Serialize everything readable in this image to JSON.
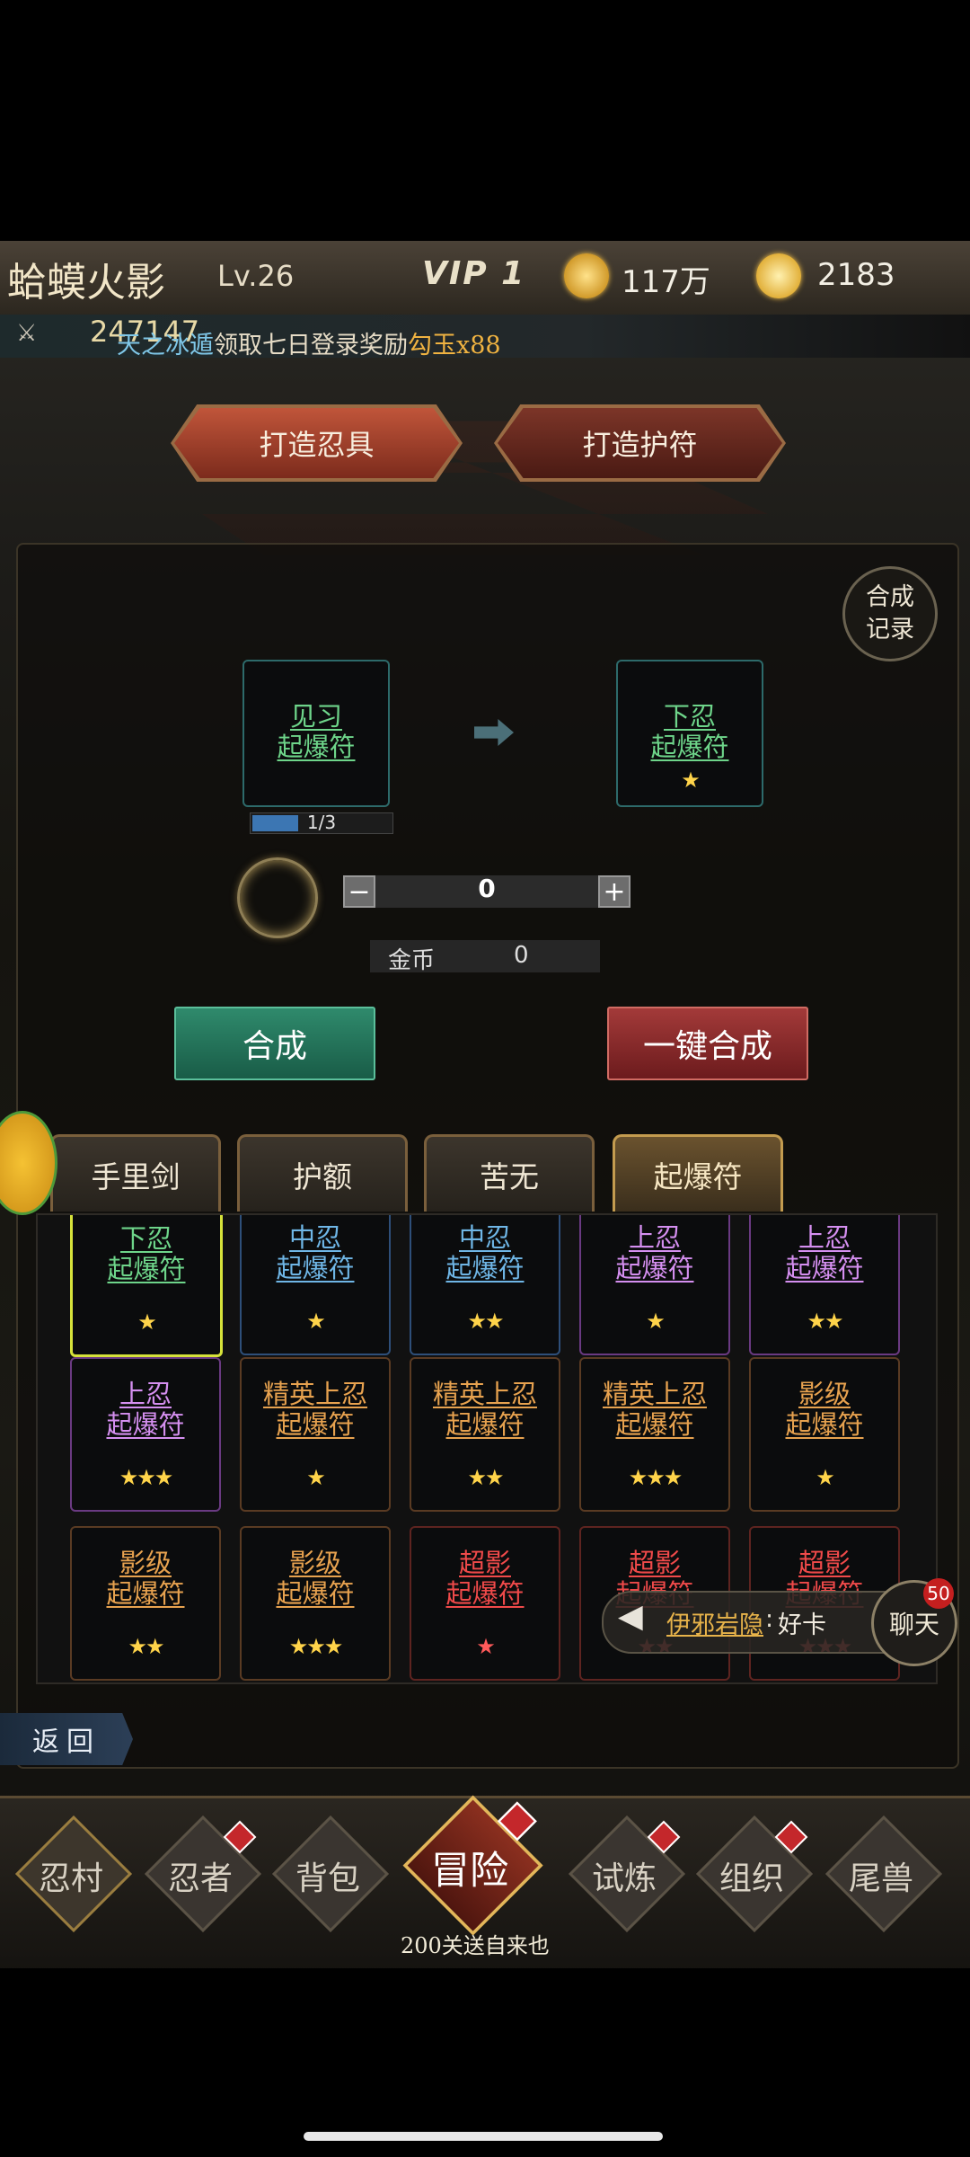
{
  "header": {
    "game_title": "蛤蟆火影",
    "level": "Lv.26",
    "vip": "VIP 1",
    "gold_amount": "117万",
    "gem_amount": "2183",
    "gold_icon": "gold-coin-plus-icon",
    "gem_icon": "magatama-plus-icon"
  },
  "ticker": {
    "power_icon": "crossed-swords-icon",
    "power": "247147",
    "player_name": "天之冰遁",
    "message_mid": "领取七日登录奖励",
    "reward": "勾玉x88"
  },
  "craft_tabs": {
    "tool": "打造忍具",
    "charm": "打造护符"
  },
  "record_button": {
    "line1": "合成",
    "line2": "记录"
  },
  "synthesis": {
    "source": {
      "line1": "见习",
      "line2": "起爆符",
      "stars": "",
      "progress_text": "1/3",
      "progress_fraction": 0.333
    },
    "target": {
      "line1": "下忍",
      "line2": "起爆符",
      "stars": "★"
    },
    "quantity": "0",
    "minus": "−",
    "plus": "+",
    "cost_label": "金币",
    "cost_value": "0",
    "synth_button": "合成",
    "one_key_button": "一键合成"
  },
  "category_tabs": [
    {
      "label": "手里剑",
      "active": false
    },
    {
      "label": "护额",
      "active": false
    },
    {
      "label": "苦无",
      "active": false
    },
    {
      "label": "起爆符",
      "active": true
    }
  ],
  "items": [
    {
      "line1": "下忍",
      "line2": "起爆符",
      "stars": "★",
      "color": "green",
      "selected": true
    },
    {
      "line1": "中忍",
      "line2": "起爆符",
      "stars": "★",
      "color": "blue"
    },
    {
      "line1": "中忍",
      "line2": "起爆符",
      "stars": "★★",
      "color": "blue"
    },
    {
      "line1": "上忍",
      "line2": "起爆符",
      "stars": "★",
      "color": "purple"
    },
    {
      "line1": "上忍",
      "line2": "起爆符",
      "stars": "★★",
      "color": "purple"
    },
    {
      "line1": "上忍",
      "line2": "起爆符",
      "stars": "★★★",
      "color": "purple"
    },
    {
      "line1": "精英上忍",
      "line2": "起爆符",
      "stars": "★",
      "color": "orange"
    },
    {
      "line1": "精英上忍",
      "line2": "起爆符",
      "stars": "★★",
      "color": "orange"
    },
    {
      "line1": "精英上忍",
      "line2": "起爆符",
      "stars": "★★★",
      "color": "orange"
    },
    {
      "line1": "影级",
      "line2": "起爆符",
      "stars": "★",
      "color": "orange"
    },
    {
      "line1": "影级",
      "line2": "起爆符",
      "stars": "★★",
      "color": "orange"
    },
    {
      "line1": "影级",
      "line2": "起爆符",
      "stars": "★★★",
      "color": "orange"
    },
    {
      "line1": "超影",
      "line2": "起爆符",
      "stars": "★",
      "color": "red"
    },
    {
      "line1": "超影",
      "line2": "起爆符",
      "stars": "★★",
      "color": "red"
    },
    {
      "line1": "超影",
      "line2": "起爆符",
      "stars": "★★★",
      "color": "red"
    }
  ],
  "chat": {
    "sender": "伊邪岩隐",
    "separator": ":",
    "message": "好卡",
    "button": "聊天",
    "badge": "50"
  },
  "back_button": "返回",
  "bottom_nav": [
    {
      "label": "忍村",
      "dot": false
    },
    {
      "label": "忍者",
      "dot": true
    },
    {
      "label": "背包",
      "dot": false
    },
    {
      "label": "冒险",
      "dot": true,
      "active": true
    },
    {
      "label": "试炼",
      "dot": true
    },
    {
      "label": "组织",
      "dot": true
    },
    {
      "label": "尾兽",
      "dot": false
    }
  ],
  "nav_caption": "200关送自来也"
}
